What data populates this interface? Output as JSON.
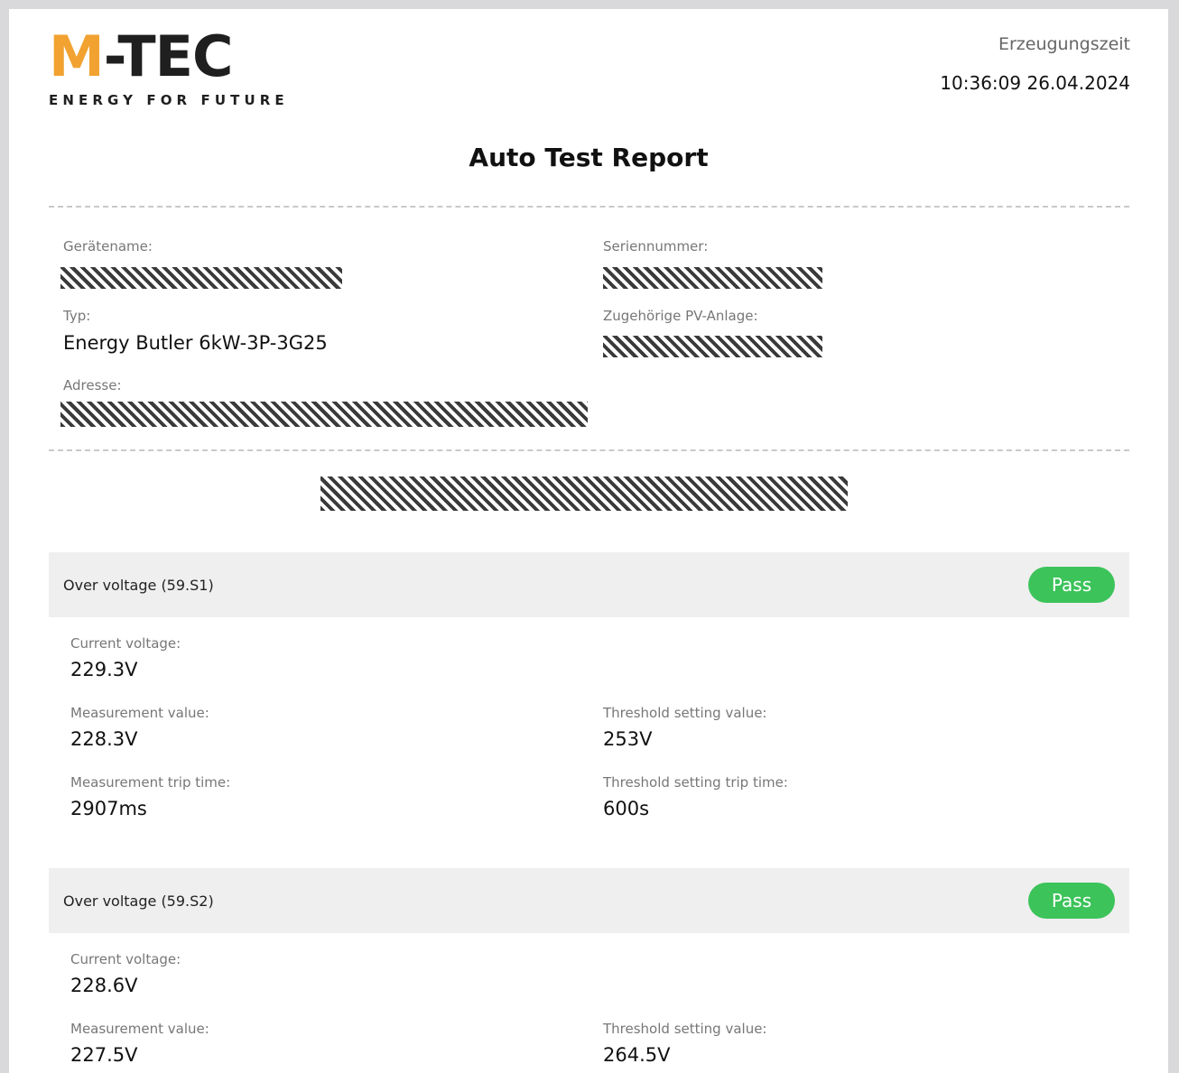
{
  "logo": {
    "brand_m": "M",
    "brand_rest": "-TEC",
    "tagline": "ENERGY FOR FUTURE"
  },
  "header": {
    "generated_label": "Erzeugungszeit",
    "generated_value": "10:36:09 26.04.2024",
    "title": "Auto Test Report"
  },
  "device": {
    "name_label": "Gerätename:",
    "serial_label": "Seriennummer:",
    "type_label": "Typ:",
    "type_value": "Energy Butler 6kW-3P-3G25",
    "pv_label": "Zugehörige PV-Anlage:",
    "address_label": "Adresse:"
  },
  "tests": [
    {
      "name": "Over voltage (59.S1)",
      "status": "Pass",
      "current_voltage_label": "Current voltage:",
      "current_voltage": "229.3V",
      "measurement_value_label": "Measurement value:",
      "measurement_value": "228.3V",
      "threshold_value_label": "Threshold setting value:",
      "threshold_value": "253V",
      "measurement_trip_label": "Measurement trip time:",
      "measurement_trip": "2907ms",
      "threshold_trip_label": "Threshold setting trip time:",
      "threshold_trip": "600s"
    },
    {
      "name": "Over voltage (59.S2)",
      "status": "Pass",
      "current_voltage_label": "Current voltage:",
      "current_voltage": "228.6V",
      "measurement_value_label": "Measurement value:",
      "measurement_value": "227.5V",
      "threshold_value_label": "Threshold setting value:",
      "threshold_value": "264.5V"
    }
  ],
  "colors": {
    "brand_orange": "#f2a230",
    "pass_green": "#3cc35a",
    "section_bg": "#efefef"
  }
}
